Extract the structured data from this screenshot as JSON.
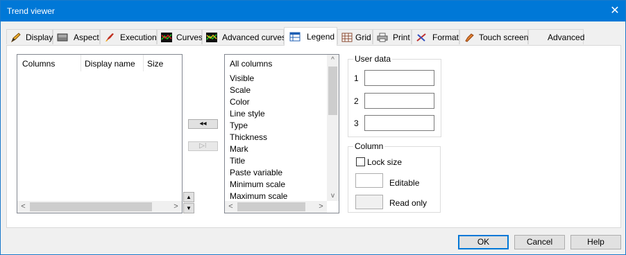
{
  "window": {
    "title": "Trend viewer"
  },
  "tabs": [
    {
      "label": "Display",
      "icon": "pencil-icon"
    },
    {
      "label": "Aspect",
      "icon": "gray-box-icon"
    },
    {
      "label": "Execution",
      "icon": "rocket-icon"
    },
    {
      "label": "Curves",
      "icon": "curves-icon"
    },
    {
      "label": "Advanced curves",
      "icon": "advanced-curves-icon"
    },
    {
      "label": "Legend",
      "icon": "legend-table-icon"
    },
    {
      "label": "Grid",
      "icon": "grid-icon"
    },
    {
      "label": "Print",
      "icon": "printer-icon"
    },
    {
      "label": "Format",
      "icon": "format-icon"
    },
    {
      "label": "Touch screen",
      "icon": "touch-hand-icon"
    },
    {
      "label": "Advanced",
      "icon": ""
    }
  ],
  "active_tab": "Legend",
  "legend_columns": {
    "headers": [
      "Columns",
      "Display name",
      "Size"
    ]
  },
  "move_buttons": {
    "add": "◂◂",
    "remove": "▷⁝"
  },
  "all_columns": {
    "header": "All columns",
    "items": [
      "Visible",
      "Scale",
      "Color",
      "Line style",
      "Type",
      "Thickness",
      "Mark",
      "Title",
      "Paste variable",
      "Minimum scale",
      "Maximum scale"
    ]
  },
  "user_data": {
    "title": "User data",
    "labels": [
      "1",
      "2",
      "3"
    ],
    "values": [
      "",
      "",
      ""
    ]
  },
  "column_group": {
    "title": "Column",
    "lock_size": "Lock size",
    "lock_size_checked": false,
    "editable": "Editable",
    "read_only": "Read only",
    "editable_color": "#ffffff",
    "read_only_color": "#f0f0f0"
  },
  "buttons": {
    "ok": "OK",
    "cancel": "Cancel",
    "help": "Help"
  },
  "colors": {
    "titlebar": "#0078d7",
    "focus": "#0078d7"
  }
}
